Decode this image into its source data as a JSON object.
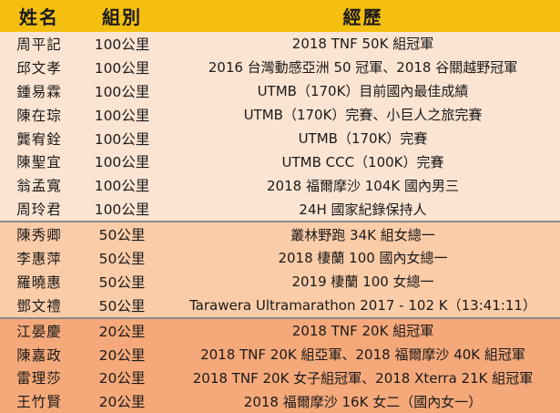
{
  "headers": {
    "name": "姓名",
    "group": "組別",
    "record": "經歷"
  },
  "band_colors": {
    "100K": "#fce4d2",
    "50K": "#fbcca8",
    "20K": "#f5a97a",
    "header": "#f5bf10"
  },
  "rows": [
    {
      "name": "周平記",
      "group": "100公里",
      "record": "2018 TNF 50K 組冠軍",
      "band": "100K"
    },
    {
      "name": "邱文孝",
      "group": "100公里",
      "record": "2016 台灣動感亞洲 50 冠軍、2018 谷關越野冠軍",
      "band": "100K"
    },
    {
      "name": "鍾易霖",
      "group": "100公里",
      "record": "UTMB（170K）目前國內最佳成績",
      "band": "100K"
    },
    {
      "name": "陳在琮",
      "group": "100公里",
      "record": "UTMB（170K）完賽、小巨人之旅完賽",
      "band": "100K"
    },
    {
      "name": "龔宥銓",
      "group": "100公里",
      "record": "UTMB（170K）完賽",
      "band": "100K"
    },
    {
      "name": "陳聖宜",
      "group": "100公里",
      "record": "UTMB CCC（100K）完賽",
      "band": "100K"
    },
    {
      "name": "翁孟寬",
      "group": "100公里",
      "record": "2018 福爾摩沙 104K 國內男三",
      "band": "100K"
    },
    {
      "name": "周玲君",
      "group": "100公里",
      "record": "24H 國家紀錄保持人",
      "band": "100K"
    },
    {
      "name": "陳秀卿",
      "group": "50公里",
      "record": "叢林野跑 34K 組女總一",
      "band": "50K"
    },
    {
      "name": "李惠萍",
      "group": "50公里",
      "record": "2018 棲蘭 100 國內女總一",
      "band": "50K"
    },
    {
      "name": "羅曉惠",
      "group": "50公里",
      "record": "2019 棲蘭 100 女總一",
      "band": "50K"
    },
    {
      "name": "鄧文禮",
      "group": "50公里",
      "record": "Tarawera Ultramarathon 2017 - 102 K（13:41:11）",
      "band": "50K"
    },
    {
      "name": "江晏慶",
      "group": "20公里",
      "record": "2018 TNF 20K 組冠軍",
      "band": "20K"
    },
    {
      "name": "陳嘉政",
      "group": "20公里",
      "record": "2018 TNF 20K 組亞軍、2018 福爾摩沙 40K 組冠軍",
      "band": "20K"
    },
    {
      "name": "雷理莎",
      "group": "20公里",
      "record": "2018 TNF 20K 女子組冠軍、2018 Xterra 21K 組冠軍",
      "band": "20K"
    },
    {
      "name": "王竹賢",
      "group": "20公里",
      "record": "2018 福爾摩沙 16K 女二（國內女一）",
      "band": "20K"
    }
  ]
}
